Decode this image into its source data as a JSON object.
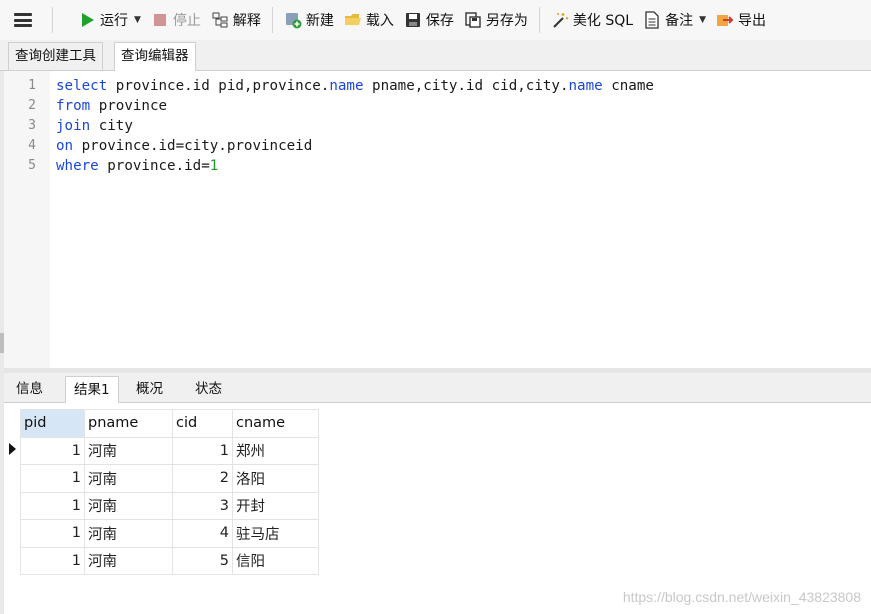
{
  "toolbar": {
    "run": "运行",
    "stop": "停止",
    "explain": "解释",
    "new": "新建",
    "load": "载入",
    "save": "保存",
    "save_as": "另存为",
    "beautify": "美化 SQL",
    "note": "备注",
    "export": "导出"
  },
  "tabs": {
    "builder": "查询创建工具",
    "editor": "查询编辑器"
  },
  "editor": {
    "lines": [
      {
        "n": "1",
        "parts": [
          [
            "kw",
            "select"
          ],
          [
            "t",
            " province.id pid,province."
          ],
          [
            "kw",
            "name"
          ],
          [
            "t",
            " pname,city.id cid,city."
          ],
          [
            "kw",
            "name"
          ],
          [
            "t",
            " cname"
          ]
        ]
      },
      {
        "n": "2",
        "parts": [
          [
            "kw",
            "from"
          ],
          [
            "t",
            " province"
          ]
        ]
      },
      {
        "n": "3",
        "parts": [
          [
            "kw",
            "join"
          ],
          [
            "t",
            " city"
          ]
        ]
      },
      {
        "n": "4",
        "parts": [
          [
            "kw",
            "on"
          ],
          [
            "t",
            " province.id=city.provinceid"
          ]
        ]
      },
      {
        "n": "5",
        "parts": [
          [
            "kw",
            "where"
          ],
          [
            "t",
            " province.id="
          ],
          [
            "num",
            "1"
          ]
        ]
      }
    ]
  },
  "result_tabs": {
    "info": "信息",
    "result1": "结果1",
    "profile": "概况",
    "status": "状态"
  },
  "grid": {
    "columns": [
      "pid",
      "pname",
      "cid",
      "cname"
    ],
    "rows": [
      [
        "1",
        "河南",
        "1",
        "郑州"
      ],
      [
        "1",
        "河南",
        "2",
        "洛阳"
      ],
      [
        "1",
        "河南",
        "3",
        "开封"
      ],
      [
        "1",
        "河南",
        "4",
        "驻马店"
      ],
      [
        "1",
        "河南",
        "5",
        "信阳"
      ]
    ]
  },
  "watermark": "https://blog.csdn.net/weixin_43823808",
  "colors": {
    "keyword": "#1b47d8",
    "number": "#1b9c2a",
    "selected_header": "#d6e6f6",
    "run_icon": "#1fa12e"
  }
}
